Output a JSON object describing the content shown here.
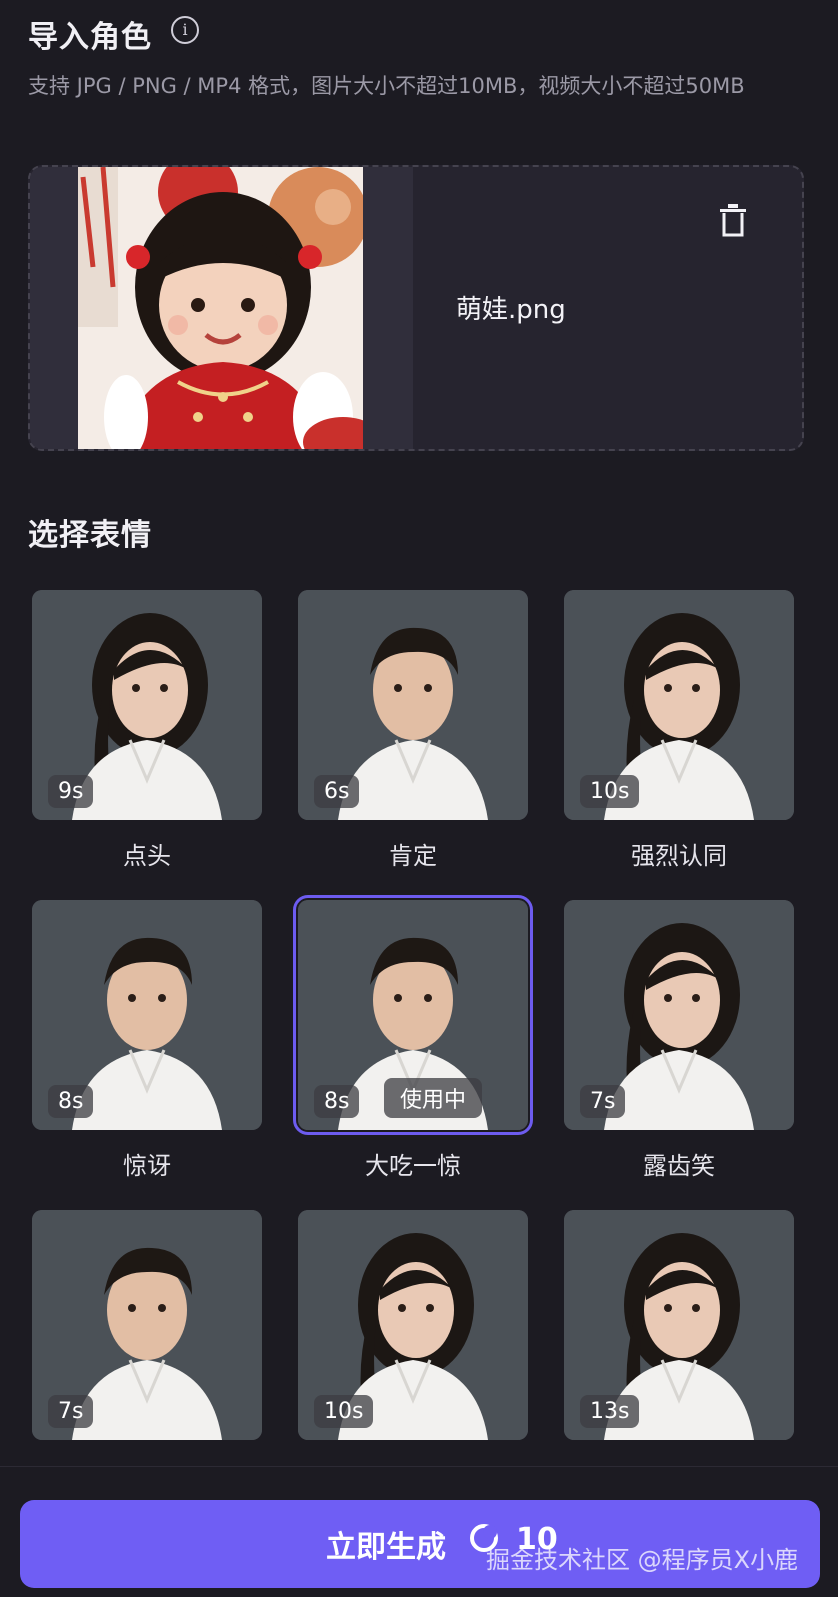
{
  "import_section": {
    "title": "导入角色",
    "info_icon": "i",
    "hint": "支持 JPG / PNG / MP4 格式，图片大小不超过10MB，视频大小不超过50MB",
    "file_name": "萌娃.png",
    "delete_icon": "trash-icon"
  },
  "expression_section": {
    "title": "选择表情",
    "cards": [
      {
        "label": "点头",
        "duration": "9s",
        "selected": false
      },
      {
        "label": "肯定",
        "duration": "6s",
        "selected": false
      },
      {
        "label": "强烈认同",
        "duration": "10s",
        "selected": false
      },
      {
        "label": "惊讶",
        "duration": "8s",
        "selected": false
      },
      {
        "label": "大吃一惊",
        "duration": "8s",
        "selected": true,
        "badge": "使用中"
      },
      {
        "label": "露齿笑",
        "duration": "7s",
        "selected": false
      },
      {
        "label": "",
        "duration": "7s",
        "selected": false
      },
      {
        "label": "",
        "duration": "10s",
        "selected": false
      },
      {
        "label": "",
        "duration": "13s",
        "selected": false
      }
    ]
  },
  "generate_button": {
    "label": "立即生成",
    "cost": "10",
    "icon": "credits-icon"
  },
  "watermark": "掘金技术社区 @程序员X小鹿",
  "colors": {
    "background": "#1c1b22",
    "accent": "#6f5ef4",
    "card_background": "#26242f"
  }
}
